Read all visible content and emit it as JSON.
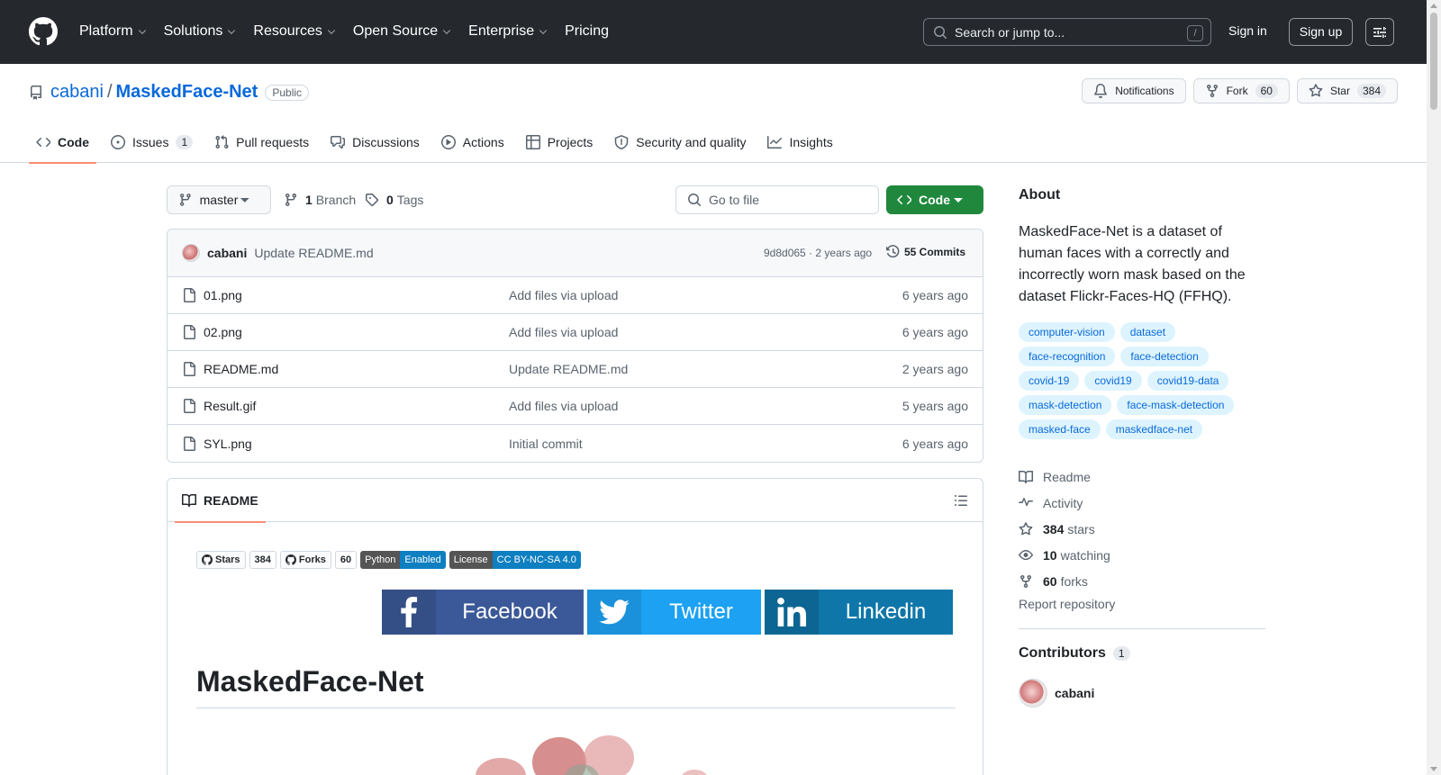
{
  "header": {
    "nav": [
      {
        "label": "Platform",
        "dropdown": true
      },
      {
        "label": "Solutions",
        "dropdown": true
      },
      {
        "label": "Resources",
        "dropdown": true
      },
      {
        "label": "Open Source",
        "dropdown": true
      },
      {
        "label": "Enterprise",
        "dropdown": true
      },
      {
        "label": "Pricing",
        "dropdown": false
      }
    ],
    "search_placeholder": "Search or jump to...",
    "search_key": "/",
    "sign_in": "Sign in",
    "sign_up": "Sign up"
  },
  "repo": {
    "owner": "cabani",
    "separator": "/",
    "name": "MaskedFace-Net",
    "visibility": "Public",
    "notifications_label": "Notifications",
    "fork_label": "Fork",
    "fork_count": "60",
    "star_label": "Star",
    "star_count": "384"
  },
  "tabs": [
    {
      "label": "Code",
      "icon": "code-icon",
      "active": true,
      "count": ""
    },
    {
      "label": "Issues",
      "icon": "issue-icon",
      "active": false,
      "count": "1"
    },
    {
      "label": "Pull requests",
      "icon": "pull-request-icon",
      "active": false,
      "count": ""
    },
    {
      "label": "Discussions",
      "icon": "discussion-icon",
      "active": false,
      "count": ""
    },
    {
      "label": "Actions",
      "icon": "play-icon",
      "active": false,
      "count": ""
    },
    {
      "label": "Projects",
      "icon": "table-icon",
      "active": false,
      "count": ""
    },
    {
      "label": "Security and quality",
      "icon": "shield-icon",
      "active": false,
      "count": ""
    },
    {
      "label": "Insights",
      "icon": "graph-icon",
      "active": false,
      "count": ""
    }
  ],
  "toolbar": {
    "branch": "master",
    "branch_count": "1",
    "branch_label": "Branch",
    "tag_count": "0",
    "tag_label": "Tags",
    "goto_placeholder": "Go to file",
    "code_label": "Code"
  },
  "commit": {
    "author": "cabani",
    "message": "Update README.md",
    "meta": "9d8d065 · 2 years ago",
    "commits_label": "55 Commits"
  },
  "files": [
    {
      "name": "01.png",
      "message": "Add files via upload",
      "age": "6 years ago"
    },
    {
      "name": "02.png",
      "message": "Add files via upload",
      "age": "6 years ago"
    },
    {
      "name": "README.md",
      "message": "Update README.md",
      "age": "2 years ago"
    },
    {
      "name": "Result.gif",
      "message": "Add files via upload",
      "age": "5 years ago"
    },
    {
      "name": "SYL.png",
      "message": "Initial commit",
      "age": "6 years ago"
    }
  ],
  "readme": {
    "tab_label": "README",
    "badges": {
      "stars_label": "Stars",
      "stars_count": "384",
      "forks_label": "Forks",
      "forks_count": "60",
      "python_left": "Python",
      "python_right": "Enabled",
      "license_left": "License",
      "license_right": "CC BY-NC-SA 4.0"
    },
    "social": {
      "facebook": "Facebook",
      "twitter": "Twitter",
      "linkedin": "Linkedin"
    },
    "title": "MaskedFace-Net"
  },
  "about": {
    "title": "About",
    "description": "MaskedFace-Net is a dataset of human faces with a correctly and incorrectly worn mask based on the dataset Flickr-Faces-HQ (FFHQ).",
    "topics": [
      "computer-vision",
      "dataset",
      "face-recognition",
      "face-detection",
      "covid-19",
      "covid19",
      "covid19-data",
      "mask-detection",
      "face-mask-detection",
      "masked-face",
      "maskedface-net"
    ],
    "links": [
      {
        "icon": "book-icon",
        "bold": "",
        "label": "Readme"
      },
      {
        "icon": "pulse-icon",
        "bold": "",
        "label": "Activity"
      },
      {
        "icon": "star-icon",
        "bold": "384",
        "label": "stars"
      },
      {
        "icon": "eye-icon",
        "bold": "10",
        "label": "watching"
      },
      {
        "icon": "fork-icon",
        "bold": "60",
        "label": "forks"
      }
    ],
    "report": "Report repository",
    "contributors_title": "Contributors",
    "contributors_count": "1",
    "contributor": "cabani"
  },
  "colors": {
    "header_bg": "#25292e",
    "link": "#0969da",
    "primary_button": "#1f883d",
    "active_tab_underline": "#fd8c73",
    "topic_bg": "#ddf4ff"
  }
}
